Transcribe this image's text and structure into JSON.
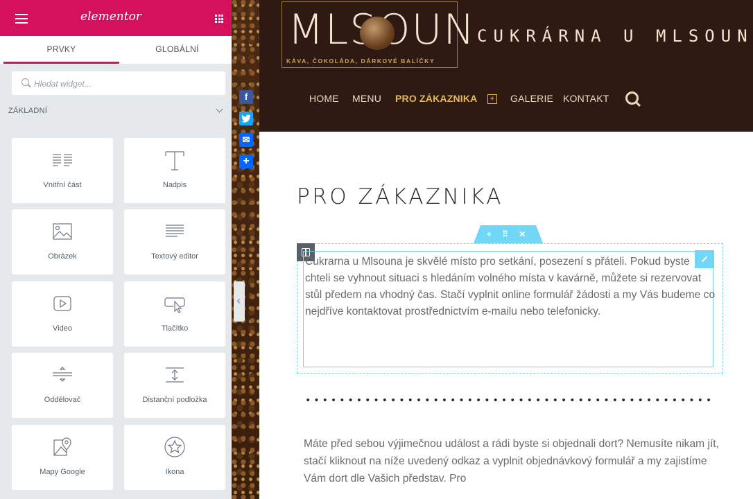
{
  "panel": {
    "brand": "elementor",
    "tabs": [
      {
        "label": "PRVKY"
      },
      {
        "label": "GLOBÁLNÍ"
      }
    ],
    "search": {
      "placeholder": "Hledat widget..."
    },
    "category": "ZÁKLADNÍ",
    "widgets": [
      {
        "label": "Vnitřní část",
        "icon": "inner-section-icon"
      },
      {
        "label": "Nadpis",
        "icon": "heading-icon"
      },
      {
        "label": "Obrázek",
        "icon": "image-icon"
      },
      {
        "label": "Textový editor",
        "icon": "text-editor-icon"
      },
      {
        "label": "Video",
        "icon": "video-icon"
      },
      {
        "label": "Tlačítko",
        "icon": "button-icon"
      },
      {
        "label": "Oddělovač",
        "icon": "divider-icon"
      },
      {
        "label": "Distanční podložka",
        "icon": "spacer-icon"
      },
      {
        "label": "Mapy Google",
        "icon": "google-maps-icon"
      },
      {
        "label": "Ikona",
        "icon": "star-icon"
      }
    ],
    "accent_color": "#d5105d"
  },
  "site": {
    "logo_text": "MLSOUN",
    "logo_sub": "KÁVA, ČOKOLÁDA, DÁRKOVÉ BALÍČKY",
    "title": "CUKRÁRNA U MLSOUNA",
    "nav": [
      {
        "label": "HOME"
      },
      {
        "label": "MENU"
      },
      {
        "label": "PRO ZÁKAZNIKA"
      },
      {
        "label": "GALERIE"
      },
      {
        "label": "KONTAKT"
      }
    ],
    "nav_active": "PRO ZÁKAZNIKA",
    "nav_plus": "+",
    "header_color": "#2e1a13"
  },
  "share": {
    "facebook": "f",
    "twitter": "t",
    "mail": "✉",
    "add": "+"
  },
  "section_tab": "+ ⠿ ✕",
  "content": {
    "page_title": "PRO ZÁKAZNIKA",
    "paragraph1": "Cukrarna u Mlsouna je skvělé místo pro setkání, posezení s přáteli. Pokud byste chteli se vyhnout situaci s hledáním volného místa v kavárně, můžete si rezervovat stůl předem na vhodný čas. Stačí vyplnit online formulář žádosti a my Vás budeme co nejdříve kontaktovat prostřednictvím e-mailu nebo telefonicky.",
    "paragraph2": "Máte před sebou výjimečnou událost a rádi byste si objednali dort? Nemusíte nikam jít, stačí kliknout na níže uvedený odkaz a vyplnit objednávkový formulář a my zajistíme Vám dort dle Vašich představ. Pro"
  }
}
